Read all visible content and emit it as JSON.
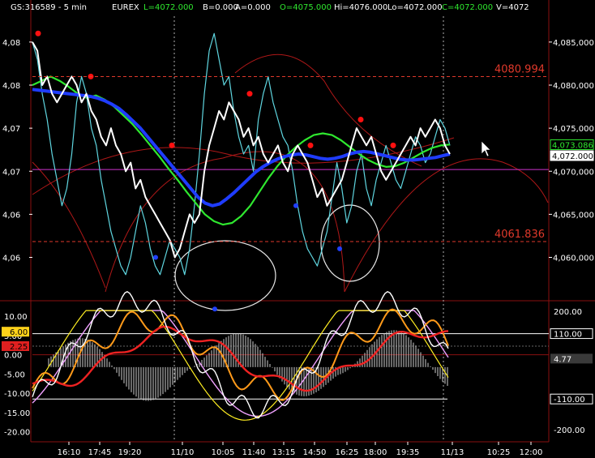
{
  "header": {
    "symbol": "GS:316589 - 5 min",
    "exchange": "EUREX",
    "last": "L=4072.000",
    "bid": "B=0.000",
    "ask": "A=0.000",
    "open": "O=4075.000",
    "high": "Hi=4076.000",
    "low": "Lo=4072.000",
    "close": "C=4072.000",
    "volume": "V=4072"
  },
  "colors": {
    "background": "#000000",
    "price": "#ffffff",
    "price_fast": "#5fd6e0",
    "ma_blue": "#1f3cff",
    "ma_green": "#2fe82f",
    "envelope_red": "#b01818",
    "level_red": "#e0392b",
    "dot_red": "#ff1010",
    "dot_blue": "#2040ff",
    "magenta_line": "#cc33cc",
    "osc_yellow": "#ffee22",
    "osc_orange": "#ff9a1a",
    "osc_red": "#ee2222",
    "osc_white": "#ffffff",
    "osc_pink": "#f0a0ff"
  },
  "chart_data": [
    {
      "type": "line",
      "panel": "price",
      "y_ticks_left": [
        "4,08",
        "4,08",
        "4,07",
        "4,07",
        "4,06",
        "4,06"
      ],
      "y_ticks_right": [
        "4,085,000",
        "4,080,000",
        "4,075,000",
        "4,070,000",
        "4,065,000",
        "4,060,000"
      ],
      "ylim": [
        4056,
        4088
      ],
      "levels": [
        {
          "label": "4080.994",
          "value": 4080.994
        },
        {
          "label": "4061.836",
          "value": 4061.836
        }
      ],
      "price_badges": [
        {
          "label": "4,073.086",
          "value": 4073.086,
          "color": "#2fe82f"
        },
        {
          "label": "4,072.000",
          "value": 4072.0,
          "color": "#ffffff"
        }
      ],
      "series": [
        {
          "key": "price",
          "values": [
            4085,
            4084,
            4080,
            4081,
            4079,
            4078,
            4079,
            4080,
            4081,
            4080,
            4078,
            4079,
            4077,
            4076,
            4074,
            4073,
            4075,
            4073,
            4072,
            4070,
            4071,
            4068,
            4069,
            4067,
            4066,
            4065,
            4064,
            4063,
            4062,
            4060,
            4061,
            4063,
            4065,
            4064,
            4065,
            4070,
            4073,
            4075,
            4077,
            4076,
            4078,
            4077,
            4076,
            4074,
            4075,
            4073,
            4074,
            4072,
            4071,
            4072,
            4073,
            4071,
            4070,
            4072,
            4073,
            4072,
            4071,
            4069,
            4067,
            4068,
            4066,
            4067,
            4068,
            4069,
            4071,
            4073,
            4075,
            4074,
            4073,
            4074,
            4072,
            4070,
            4069,
            4070,
            4071,
            4072,
            4073,
            4074,
            4073,
            4075,
            4074,
            4075,
            4076,
            4075,
            4073,
            4072
          ]
        },
        {
          "key": "price_fast",
          "values": [
            4085,
            4083,
            4079,
            4076,
            4072,
            4069,
            4066,
            4068,
            4072,
            4078,
            4081,
            4079,
            4075,
            4073,
            4069,
            4066,
            4063,
            4061,
            4059,
            4058,
            4060,
            4063,
            4066,
            4064,
            4061,
            4059,
            4058,
            4060,
            4062,
            4061,
            4060,
            4058,
            4061,
            4066,
            4072,
            4079,
            4084,
            4086,
            4083,
            4080,
            4081,
            4077,
            4074,
            4072,
            4073,
            4070,
            4076,
            4079,
            4081,
            4078,
            4076,
            4074,
            4073,
            4070,
            4066,
            4063,
            4061,
            4060,
            4059,
            4061,
            4063,
            4067,
            4071,
            4068,
            4064,
            4066,
            4070,
            4072,
            4068,
            4066,
            4069,
            4071,
            4073,
            4071,
            4069,
            4068,
            4070,
            4072,
            4074,
            4073,
            4071,
            4072,
            4074,
            4076,
            4075,
            4073
          ]
        },
        {
          "key": "ma_blue",
          "values": [
            4079.5,
            4079.4,
            4079.3,
            4079.2,
            4079.1,
            4079.0,
            4078.9,
            4078.8,
            4078.7,
            4078.5,
            4078.2,
            4077.8,
            4077.3,
            4076.6,
            4075.8,
            4075.0,
            4074.0,
            4073.0,
            4072.0,
            4071.0,
            4070.0,
            4069.0,
            4068.0,
            4067.0,
            4066.3,
            4066.0,
            4066.2,
            4066.8,
            4067.5,
            4068.3,
            4069.1,
            4069.9,
            4070.5,
            4071.0,
            4071.4,
            4071.7,
            4071.9,
            4072.0,
            4071.9,
            4071.7,
            4071.5,
            4071.4,
            4071.5,
            4071.7,
            4072.0,
            4072.2,
            4072.3,
            4072.2,
            4072.0,
            4071.8,
            4071.6,
            4071.4,
            4071.3,
            4071.3,
            4071.4,
            4071.5,
            4071.6,
            4071.8,
            4072.0
          ]
        },
        {
          "key": "ma_green",
          "values": [
            4080,
            4080.5,
            4081,
            4080.5,
            4079.8,
            4079.0,
            4078.5,
            4078.8,
            4078.3,
            4077.5,
            4076.5,
            4075.5,
            4074.3,
            4073.0,
            4071.7,
            4070.3,
            4069.0,
            4067.6,
            4066.3,
            4065.0,
            4064.2,
            4063.8,
            4064.0,
            4064.8,
            4066.0,
            4067.6,
            4069.2,
            4070.6,
            4071.8,
            4072.8,
            4073.6,
            4074.2,
            4074.4,
            4074.2,
            4073.6,
            4072.8,
            4072.0,
            4071.3,
            4070.8,
            4070.5,
            4070.6,
            4071.0,
            4071.6,
            4072.2,
            4072.7,
            4073.0,
            4073.1
          ]
        }
      ],
      "markers_red": [
        4086,
        4081,
        4073,
        4079,
        4073,
        4076,
        4073
      ],
      "markers_blue": [
        4060,
        4054,
        4066,
        4061
      ]
    },
    {
      "type": "line",
      "panel": "oscillator",
      "y_ticks_left": [
        "10.00",
        "5.00",
        "0.00",
        "-5.00",
        "-10.00",
        "-15.00",
        "-20.00"
      ],
      "y_ticks_right": [
        "200.00",
        "110.00",
        "4.77",
        "-110.00",
        "-200.00"
      ],
      "ylim": [
        -22,
        13
      ],
      "badges_left": [
        {
          "label": "6.00",
          "color": "#ffd21a"
        },
        {
          "label": "2.25",
          "color": "#e02020"
        }
      ],
      "reference_levels": [
        {
          "label": "110.00",
          "value": 110
        },
        {
          "label": "-110.00",
          "value": -110
        }
      ],
      "current_value": {
        "label": "4.77"
      }
    }
  ],
  "x_ticks": [
    "16:10",
    "17:45",
    "19:20",
    "11/10",
    "10:05",
    "11:40",
    "13:15",
    "14:50",
    "16:25",
    "18:00",
    "19:35",
    "11/13",
    "10:25",
    "12:00"
  ]
}
